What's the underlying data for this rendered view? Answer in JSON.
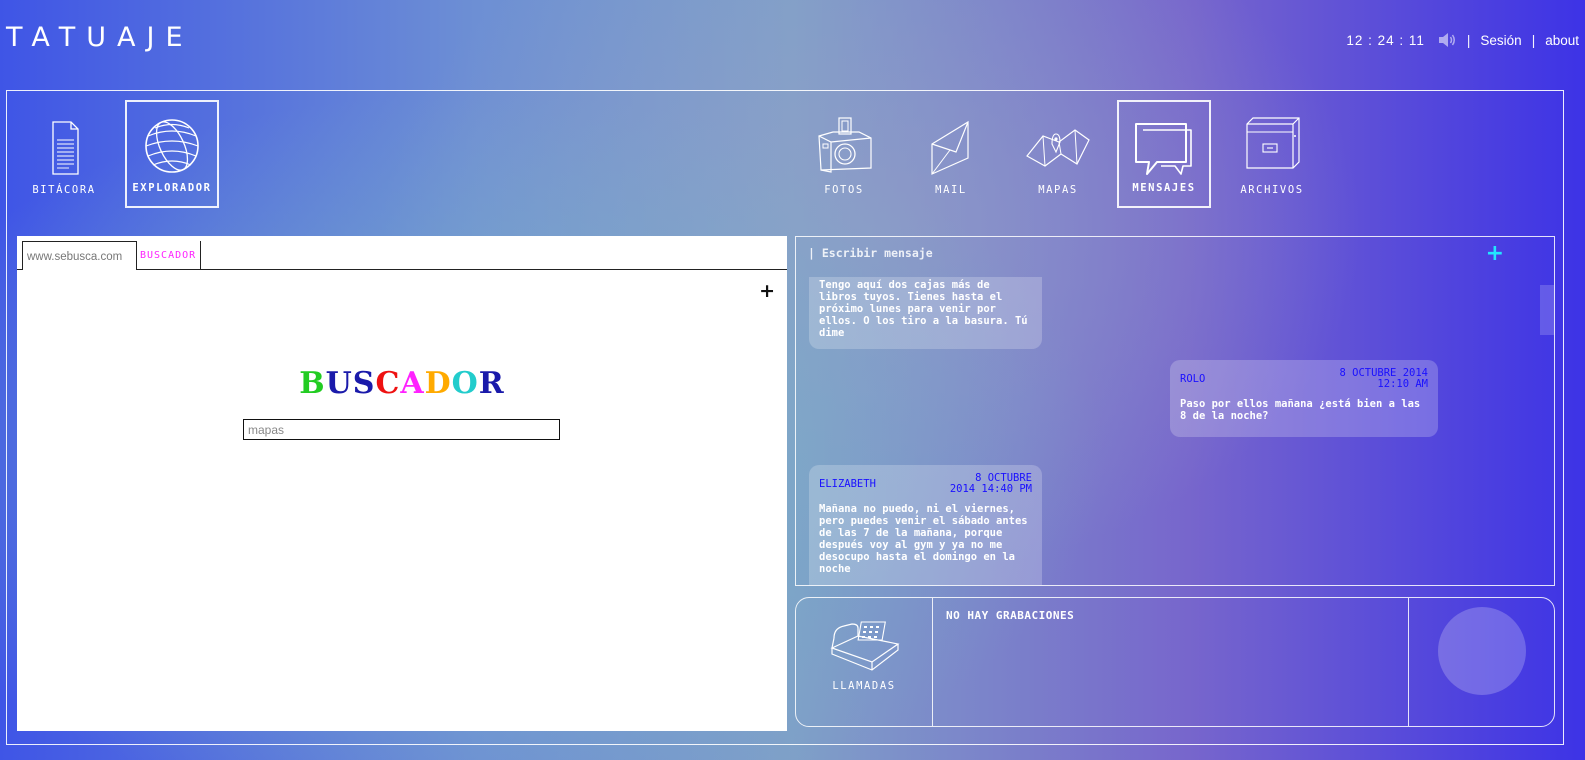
{
  "app": {
    "title": "TATUAJE"
  },
  "topbar": {
    "time": "12 : 24 : 11",
    "sound_icon": "speaker-icon",
    "sep1": "|",
    "session": "Sesión",
    "sep2": "|",
    "about": "about"
  },
  "nav": {
    "left": [
      {
        "label": "BITÁCORA",
        "icon": "document-icon",
        "active": false
      },
      {
        "label": "EXPLORADOR",
        "icon": "globe-icon",
        "active": true
      }
    ],
    "right": [
      {
        "label": "FOTOS",
        "icon": "camera-icon",
        "active": false
      },
      {
        "label": "MAIL",
        "icon": "envelope-icon",
        "active": false
      },
      {
        "label": "MAPAS",
        "icon": "map-icon",
        "active": false
      },
      {
        "label": "MENSAJES",
        "icon": "speech-bubble-icon",
        "active": true
      },
      {
        "label": "ARCHIVOS",
        "icon": "cabinet-icon",
        "active": false
      }
    ]
  },
  "browser": {
    "url": "www.sebusca.com",
    "tab_label": "BUSCADOR",
    "new_tab": "+",
    "logo_letters": [
      {
        "char": "B",
        "color": "#22cc22"
      },
      {
        "char": "U",
        "color": "#1a1aaa"
      },
      {
        "char": "S",
        "color": "#1a1aaa"
      },
      {
        "char": "C",
        "color": "#ee1111"
      },
      {
        "char": "A",
        "color": "#ff22ff"
      },
      {
        "char": "D",
        "color": "#ffaa00"
      },
      {
        "char": "O",
        "color": "#22cccc"
      },
      {
        "char": "R",
        "color": "#1a1aaa"
      }
    ],
    "search_value": "mapas"
  },
  "messages": {
    "input_placeholder": "| Escribir mensaje",
    "add": "+",
    "items": [
      {
        "sender": "",
        "date": "",
        "body": "Tengo aquí dos cajas más de libros tuyos. Tienes hasta el próximo lunes para venir por ellos. O los tiro a la basura. Tú dime"
      },
      {
        "sender": "ROLO",
        "date": "8 OCTUBRE 2014 12:10 AM",
        "date_line1": "8 OCTUBRE 2014",
        "date_line2": "12:10 AM",
        "body": "Paso por ellos mañana ¿está bien a las 8 de la noche?"
      },
      {
        "sender": "ELIZABETH",
        "date": "8 OCTUBRE 2014 14:40 PM",
        "date_line1": "8 OCTUBRE",
        "date_line2": "2014 14:40 PM",
        "body": "Mañana no puedo, ni el viernes, pero puedes venir el sábado antes de las 7 de la mañana, porque después voy al gym y ya no me desocupo hasta el domingo en la noche"
      }
    ]
  },
  "calls": {
    "label": "LLAMADAS",
    "icon": "telephone-icon",
    "status": "NO HAY GRABACIONES"
  }
}
